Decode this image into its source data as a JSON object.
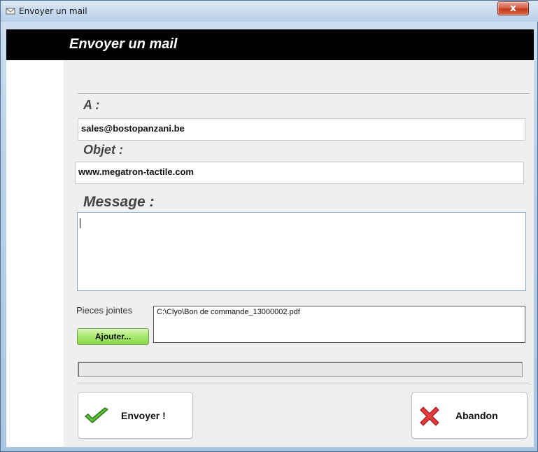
{
  "window": {
    "title": "Envoyer un mail",
    "close_glyph": "x"
  },
  "header": {
    "title": "Envoyer un mail"
  },
  "form": {
    "to_label": "A :",
    "to_value": "sales@bostopanzani.be",
    "subject_label": "Objet :",
    "subject_value": "www.megatron-tactile.com",
    "message_label": "Message :",
    "message_value": "",
    "attachments_label": "Pieces jointes",
    "attachments_list": [
      "C:\\Clyo\\Bon de commande_13000002.pdf"
    ],
    "add_button_label": "Ajouter..."
  },
  "progress": {
    "value": 0
  },
  "actions": {
    "send_label": "Envoyer !",
    "cancel_label": "Abandon"
  },
  "icons": {
    "app": "mail-app-icon",
    "send": "checkmark-icon",
    "cancel": "red-x-icon"
  },
  "colors": {
    "header_bg": "#000000",
    "accent_green": "#8ed84d",
    "check_green": "#4fae2b",
    "cancel_red": "#d22a2a"
  }
}
